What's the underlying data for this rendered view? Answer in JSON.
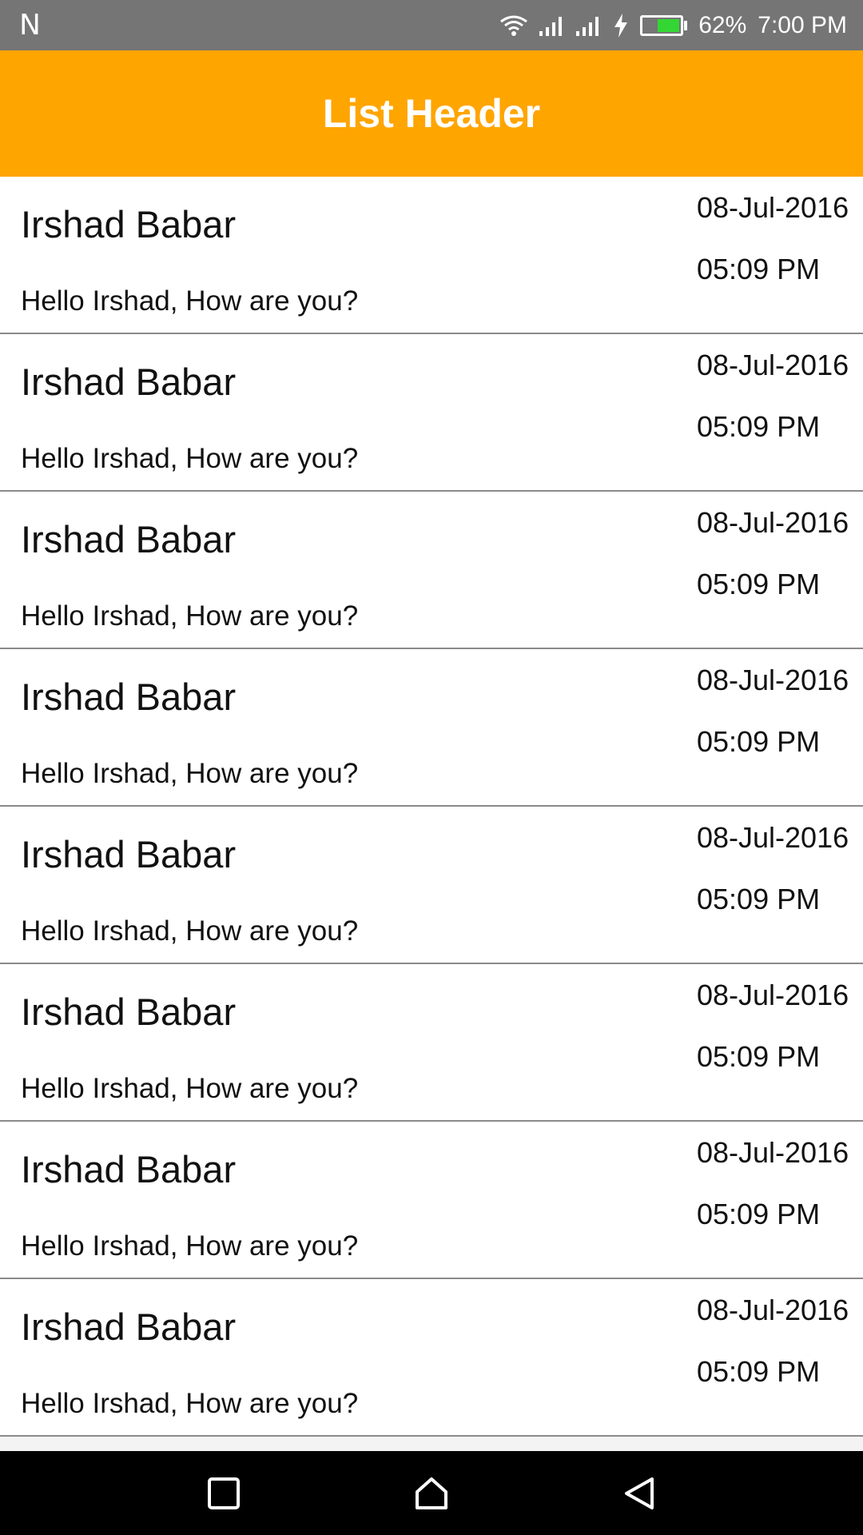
{
  "status_bar": {
    "left_glyph": "N",
    "battery_percent": "62%",
    "battery_level": 0.62,
    "time": "7:00 PM",
    "icons": [
      "wifi-icon",
      "signal-icon",
      "signal-icon",
      "charging-icon",
      "battery-icon"
    ]
  },
  "header": {
    "title": "List Header",
    "background": "#FFA500"
  },
  "list": {
    "items": [
      {
        "name": "Irshad Babar",
        "message": "Hello Irshad, How are you?",
        "date": "08-Jul-2016",
        "time": "05:09 PM"
      },
      {
        "name": "Irshad Babar",
        "message": "Hello Irshad, How are you?",
        "date": "08-Jul-2016",
        "time": "05:09 PM"
      },
      {
        "name": "Irshad Babar",
        "message": "Hello Irshad, How are you?",
        "date": "08-Jul-2016",
        "time": "05:09 PM"
      },
      {
        "name": "Irshad Babar",
        "message": "Hello Irshad, How are you?",
        "date": "08-Jul-2016",
        "time": "05:09 PM"
      },
      {
        "name": "Irshad Babar",
        "message": "Hello Irshad, How are you?",
        "date": "08-Jul-2016",
        "time": "05:09 PM"
      },
      {
        "name": "Irshad Babar",
        "message": "Hello Irshad, How are you?",
        "date": "08-Jul-2016",
        "time": "05:09 PM"
      },
      {
        "name": "Irshad Babar",
        "message": "Hello Irshad, How are you?",
        "date": "08-Jul-2016",
        "time": "05:09 PM"
      },
      {
        "name": "Irshad Babar",
        "message": "Hello Irshad, How are you?",
        "date": "08-Jul-2016",
        "time": "05:09 PM"
      }
    ]
  },
  "nav_bar": {
    "buttons": [
      "recents-icon",
      "home-icon",
      "back-icon"
    ]
  }
}
